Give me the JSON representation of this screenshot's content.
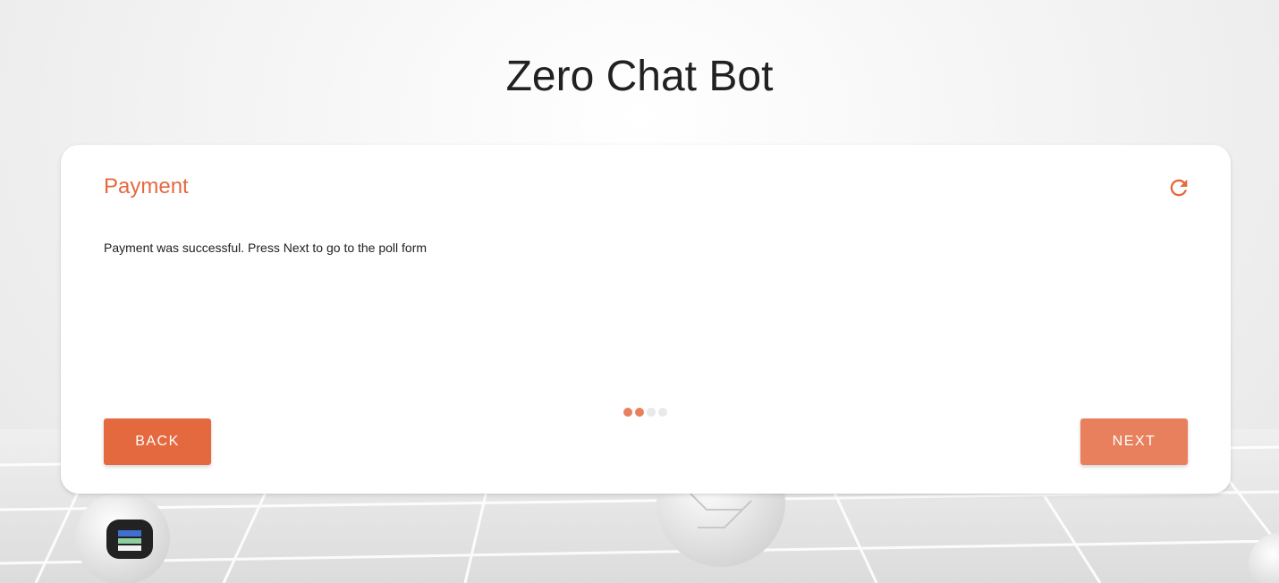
{
  "header": {
    "title": "Zero Chat Bot"
  },
  "card": {
    "title": "Payment",
    "message": "Payment was successful. Press Next to go to the poll form",
    "refresh_icon": "refresh-icon"
  },
  "stepper": {
    "total_steps": 4,
    "completed_steps": 2
  },
  "buttons": {
    "back_label": "Back",
    "next_label": "Next"
  },
  "colors": {
    "accent": "#e4693f",
    "accent_light": "#e8805e",
    "title_text": "#212121"
  }
}
